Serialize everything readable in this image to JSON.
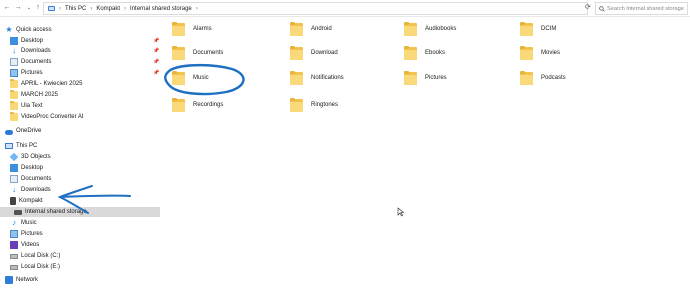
{
  "address_bar": {
    "back": "←",
    "forward": "→",
    "recent": "⌄",
    "up": "↑",
    "crumbs": [
      "This PC",
      "Kompakt",
      "Internal shared storage"
    ],
    "search_placeholder": "Search Internal shared storage"
  },
  "sidebar": {
    "quick_access": {
      "label": "Quick access",
      "items": [
        {
          "label": "Desktop",
          "pinned": true
        },
        {
          "label": "Downloads",
          "pinned": true
        },
        {
          "label": "Documents",
          "pinned": true
        },
        {
          "label": "Pictures",
          "pinned": true
        },
        {
          "label": "APRIL - Kwiecien 2025"
        },
        {
          "label": "MARCH 2025"
        },
        {
          "label": "Ula Text"
        },
        {
          "label": "VideoProc Converter AI"
        }
      ]
    },
    "onedrive": "OneDrive",
    "this_pc": {
      "label": "This PC",
      "items": [
        "3D Objects",
        "Desktop",
        "Documents",
        "Downloads",
        "Kompakt",
        "Internal shared storage",
        "Music",
        "Pictures",
        "Videos",
        "Local Disk (C:)",
        "Local Disk (E:)"
      ]
    },
    "network": "Network",
    "selected": "Internal shared storage"
  },
  "folders": [
    "Alarms",
    "Android",
    "Audiobooks",
    "DCIM",
    "Documents",
    "Download",
    "Ebooks",
    "Movies",
    "Music",
    "Notifications",
    "Pictures",
    "Podcasts",
    "Recordings",
    "Ringtones"
  ],
  "colors": {
    "annotation": "#1f6fc2",
    "folder": "#f8d775",
    "selected_row": "#d9d9d9"
  }
}
